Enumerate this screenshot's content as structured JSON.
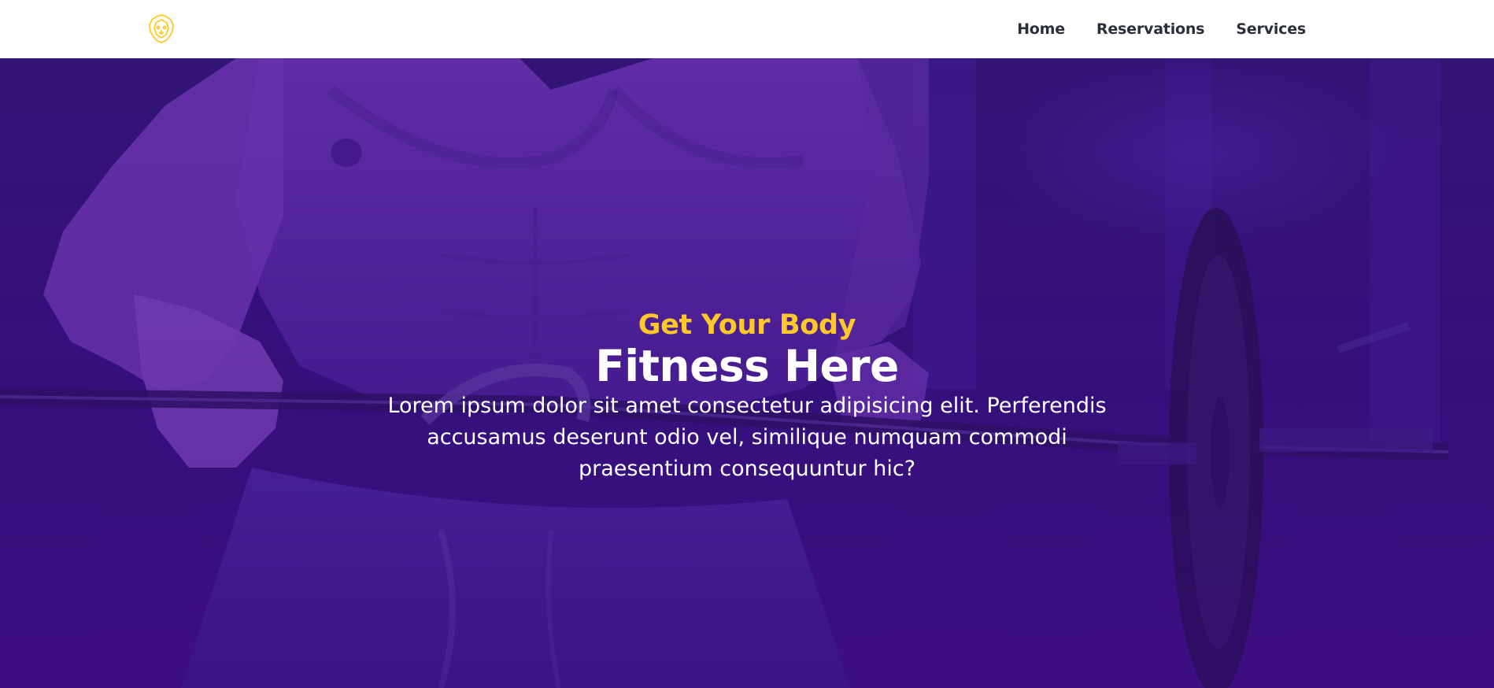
{
  "header": {
    "logo_icon": "lion-head-icon",
    "nav": [
      {
        "label": "Home"
      },
      {
        "label": "Reservations"
      },
      {
        "label": "Services"
      }
    ]
  },
  "hero": {
    "background_image": "fitness-man-barbell-photo",
    "subtitle": "Get Your Body",
    "title": "Fitness Here",
    "description": "Lorem ipsum dolor sit amet consectetur adipisicing elit. Perferendis accusamus deserunt odio vel, similique numquam commodi praesentium consequuntur hic?"
  },
  "colors": {
    "accent": "#ffc829",
    "hero_bg": "#34107a",
    "nav_text": "#2b2f3a",
    "header_bg": "#ffffff"
  }
}
